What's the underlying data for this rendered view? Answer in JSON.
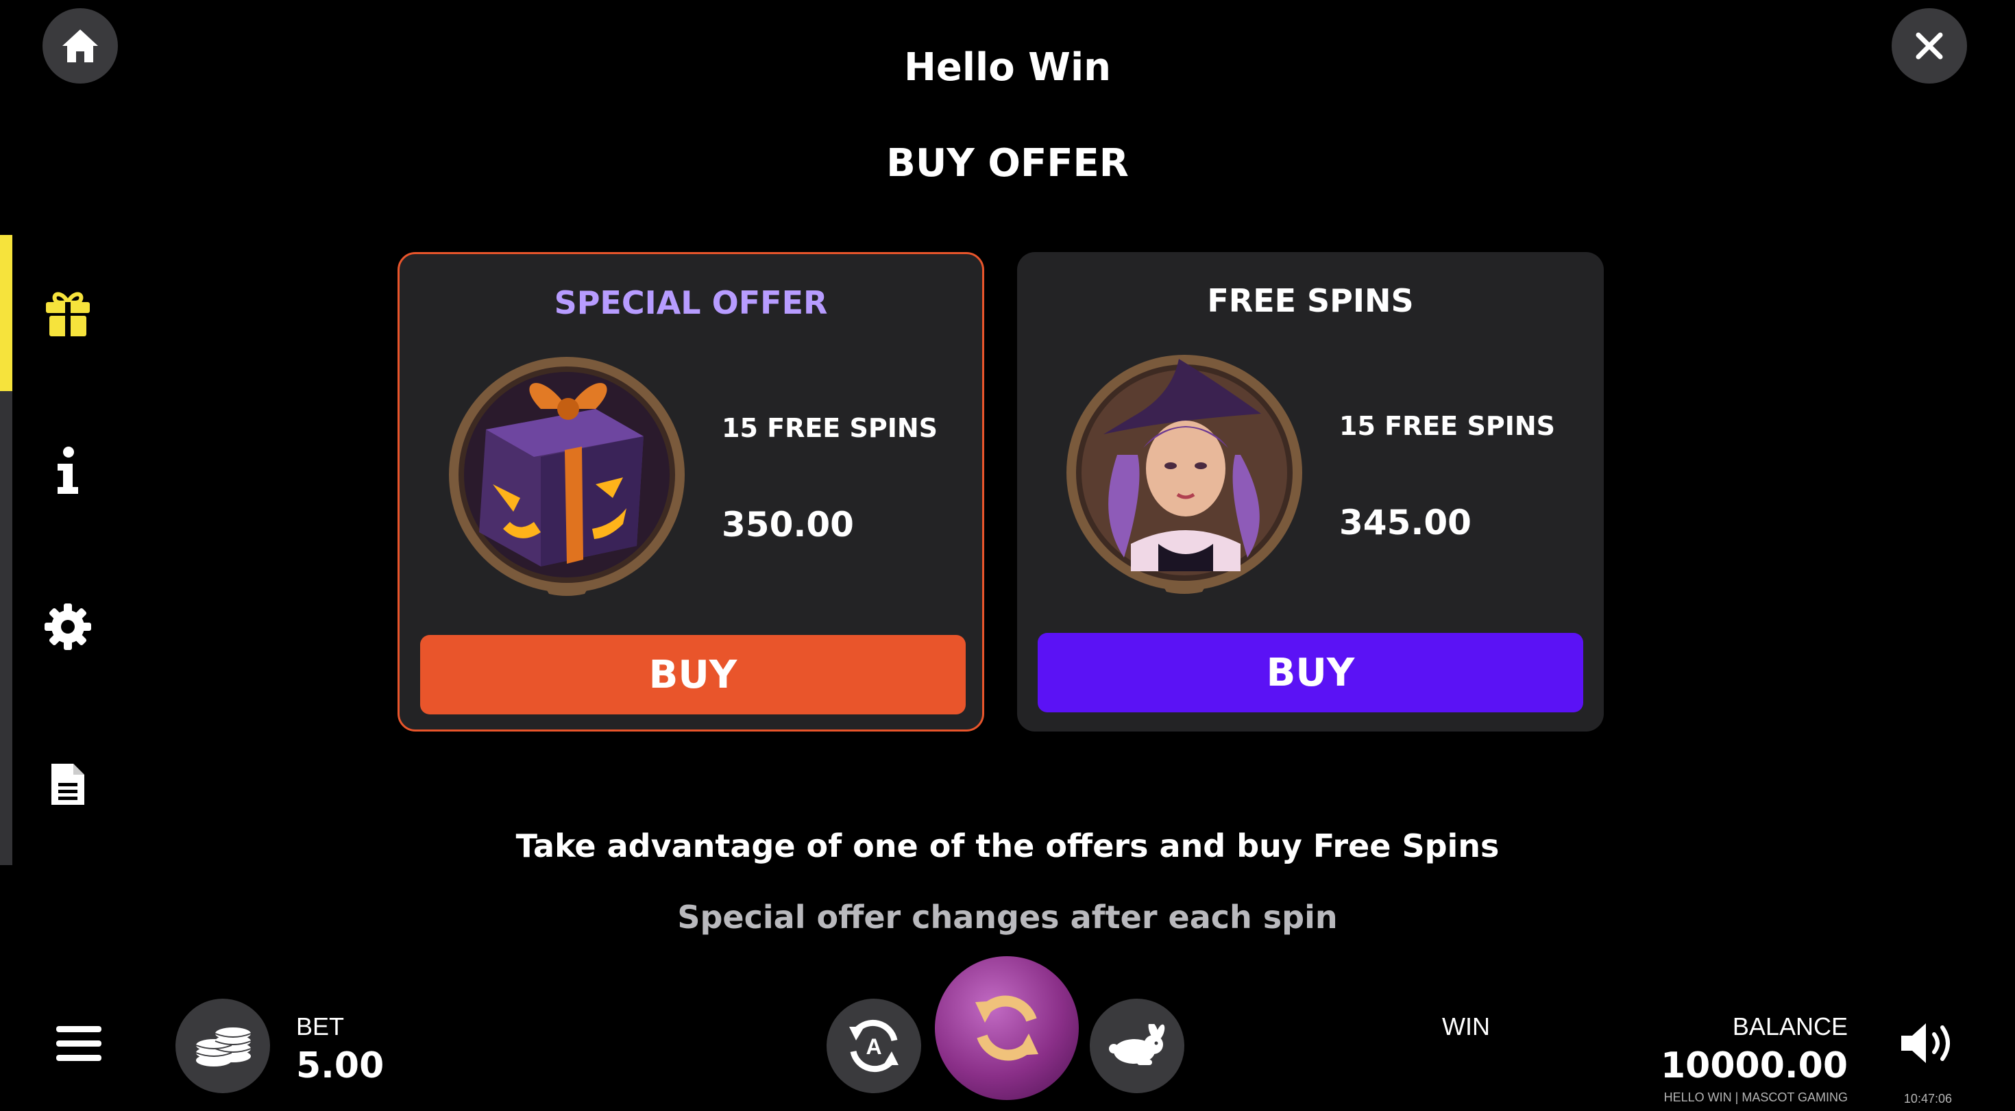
{
  "header": {
    "title": "Hello Win",
    "subtitle": "BUY OFFER"
  },
  "sidebar": {
    "items": [
      {
        "icon": "gift-icon",
        "active": true
      },
      {
        "icon": "info-icon",
        "active": false
      },
      {
        "icon": "gear-icon",
        "active": false
      },
      {
        "icon": "document-icon",
        "active": false
      }
    ]
  },
  "offers": [
    {
      "title": "SPECIAL OFFER",
      "title_color": "#b79cff",
      "image": "halloween-gift-box",
      "spins": "15 FREE SPINS",
      "price": "350.00",
      "button_label": "BUY",
      "button_color": "#e9552b"
    },
    {
      "title": "FREE SPINS",
      "title_color": "#ffffff",
      "image": "witch-portrait",
      "spins": "15 FREE SPINS",
      "price": "345.00",
      "button_label": "BUY",
      "button_color": "#5b12f5"
    }
  ],
  "notes": [
    "Take advantage of one of the offers and buy Free Spins",
    "Special offer changes after each spin"
  ],
  "footer": {
    "bet_label": "BET",
    "bet_value": "5.00",
    "win_label": "WIN",
    "balance_label": "BALANCE",
    "balance_value": "10000.00",
    "brand": "HELLO WIN | MASCOT GAMING",
    "time": "10:47:06"
  },
  "colors": {
    "accent_yellow": "#f6e33c",
    "special_orange": "#e9552b",
    "free_purple": "#5b12f5"
  }
}
